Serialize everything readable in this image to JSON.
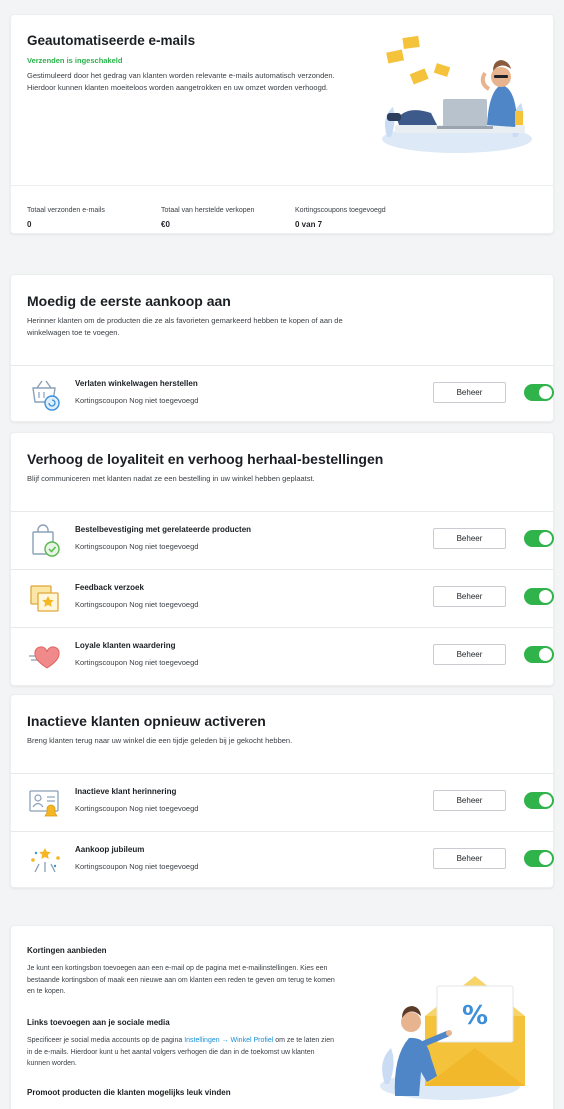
{
  "hero": {
    "title": "Geautomatiseerde e-mails",
    "status": "Verzenden is ingeschakeld",
    "description": "Gestimuleerd door het gedrag van klanten worden relevante e-mails automatisch verzonden. Hierdoor kunnen klanten moeiteloos worden aangetrokken en uw omzet worden verhoogd.",
    "stats": [
      {
        "label": "Totaal verzonden e-mails",
        "value": "0"
      },
      {
        "label": "Totaal van herstelde verkopen",
        "value": "€0"
      },
      {
        "label": "Kortingscoupons toegevoegd",
        "value": "0 van 7"
      }
    ]
  },
  "sections": [
    {
      "title": "Moedig de eerste aankoop aan",
      "description": "Herinner klanten om de producten die ze als favorieten gemarkeerd hebben te kopen of aan de winkelwagen toe te voegen.",
      "items": [
        {
          "title": "Verlaten winkelwagen herstellen",
          "subtitle": "Kortingscoupon Nog niet toegevoegd",
          "button": "Beheer",
          "icon": "cart-restore-icon",
          "enabled": true
        }
      ]
    },
    {
      "title": "Verhoog de loyaliteit en verhoog herhaal-bestellingen",
      "description": "Blijf communiceren met klanten nadat ze een bestelling in uw winkel hebben geplaatst.",
      "items": [
        {
          "title": "Bestelbevestiging met gerelateerde producten",
          "subtitle": "Kortingscoupon Nog niet toegevoegd",
          "button": "Beheer",
          "icon": "shopping-bag-check-icon",
          "enabled": true
        },
        {
          "title": "Feedback verzoek",
          "subtitle": "Kortingscoupon Nog niet toegevoegd",
          "button": "Beheer",
          "icon": "feedback-star-icon",
          "enabled": true
        },
        {
          "title": "Loyale klanten waardering",
          "subtitle": "Kortingscoupon Nog niet toegevoegd",
          "button": "Beheer",
          "icon": "heart-icon",
          "enabled": true
        }
      ]
    },
    {
      "title": "Inactieve klanten opnieuw activeren",
      "description": "Breng klanten terug naar uw winkel die een tijdje geleden bij je gekocht hebben.",
      "items": [
        {
          "title": "Inactieve klant herinnering",
          "subtitle": "Kortingscoupon Nog niet toegevoegd",
          "button": "Beheer",
          "icon": "profile-bell-icon",
          "enabled": true
        },
        {
          "title": "Aankoop jubileum",
          "subtitle": "Kortingscoupon Nog niet toegevoegd",
          "button": "Beheer",
          "icon": "celebration-icon",
          "enabled": true
        }
      ]
    }
  ],
  "info": {
    "discounts_title": "Kortingen aanbieden",
    "discounts_text": "Je kunt een kortingsbon toevoegen aan een e-mail op de pagina met e-mailinstellingen. Kies een bestaande kortingsbon of maak een nieuwe aan om klanten een reden te geven om terug te komen en te kopen.",
    "social_title": "Links toevoegen aan je sociale media",
    "social_text_before": "Specificeer je social media accounts op de pagina ",
    "social_link": "Instellingen → Winkel Profiel",
    "social_text_after": " om ze te laten zien in de e-mails. Hierdoor kunt u het aantal volgers verhogen die dan in de toekomst uw klanten kunnen worden.",
    "promote_title": "Promoot producten die klanten mogelijks leuk vinden"
  },
  "colors": {
    "toggle_on": "#2fb34a",
    "status_green": "#2bb24c",
    "link_blue": "#1a8fd6",
    "envelope_yellow": "#f5c33b"
  }
}
